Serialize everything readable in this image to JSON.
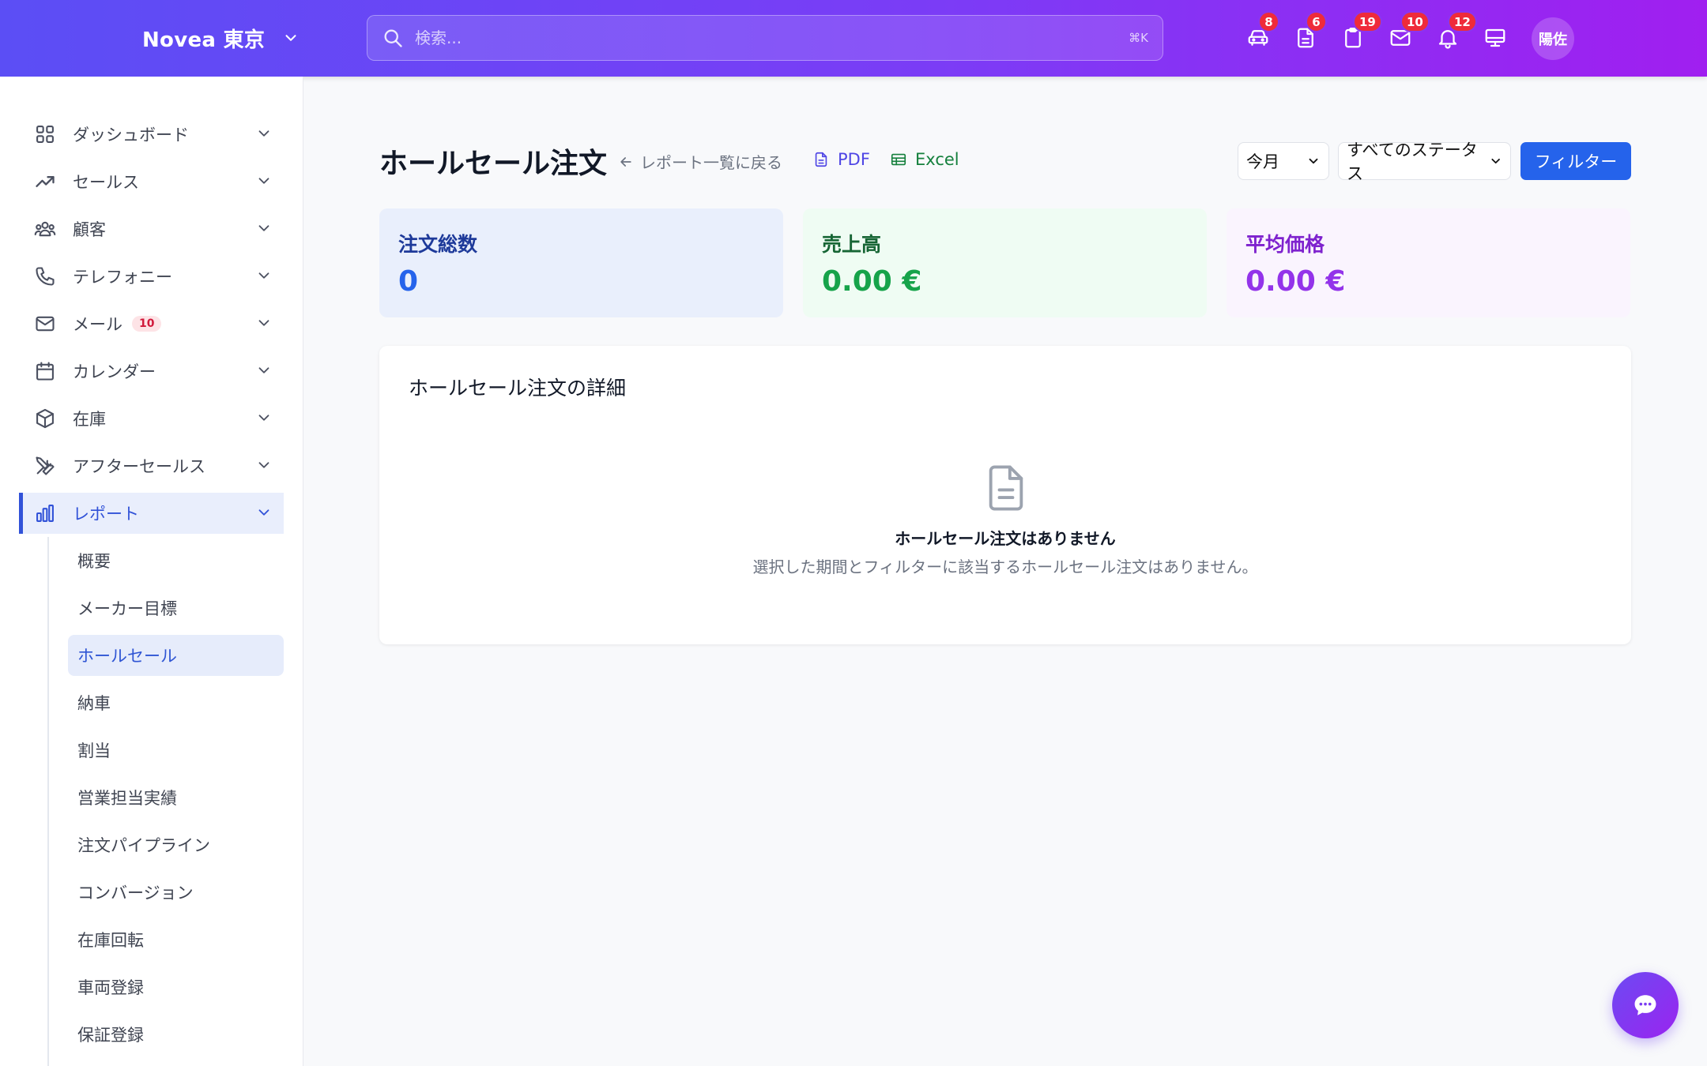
{
  "header": {
    "brand": "Novea 東京",
    "search_placeholder": "検索...",
    "search_shortcut": "⌘K",
    "icons": [
      {
        "name": "car-icon",
        "badge": "8"
      },
      {
        "name": "document-icon",
        "badge": "6"
      },
      {
        "name": "clipboard-icon",
        "badge": "19"
      },
      {
        "name": "mail-icon",
        "badge": "10"
      },
      {
        "name": "bell-icon",
        "badge": "12"
      },
      {
        "name": "monitor-icon",
        "badge": ""
      }
    ],
    "avatar": "陽佐"
  },
  "sidebar": {
    "items": [
      {
        "label": "ダッシュボード",
        "icon": "grid-icon"
      },
      {
        "label": "セールス",
        "icon": "trending-up-icon"
      },
      {
        "label": "顧客",
        "icon": "users-icon"
      },
      {
        "label": "テレフォニー",
        "icon": "phone-icon"
      },
      {
        "label": "メール",
        "icon": "mail-icon",
        "badge": "10"
      },
      {
        "label": "カレンダー",
        "icon": "calendar-icon"
      },
      {
        "label": "在庫",
        "icon": "box-icon"
      },
      {
        "label": "アフターセールス",
        "icon": "tools-icon"
      },
      {
        "label": "レポート",
        "icon": "bar-chart-icon",
        "active": true
      }
    ],
    "subitems": [
      {
        "label": "概要"
      },
      {
        "label": "メーカー目標"
      },
      {
        "label": "ホールセール",
        "active": true
      },
      {
        "label": "納車"
      },
      {
        "label": "割当"
      },
      {
        "label": "営業担当実績"
      },
      {
        "label": "注文パイプライン"
      },
      {
        "label": "コンバージョン"
      },
      {
        "label": "在庫回転"
      },
      {
        "label": "車両登録"
      },
      {
        "label": "保証登録"
      }
    ]
  },
  "main": {
    "title": "ホールセール注文",
    "back_label": "レポート一覧に戻る",
    "pdf_label": "PDF",
    "excel_label": "Excel",
    "period_select": "今月",
    "status_select": "すべてのステータス",
    "filter_button": "フィルター",
    "stats": [
      {
        "label": "注文総数",
        "value": "0"
      },
      {
        "label": "売上高",
        "value": "0.00 €"
      },
      {
        "label": "平均価格",
        "value": "0.00 €"
      }
    ],
    "detail": {
      "title": "ホールセール注文の詳細",
      "empty_title": "ホールセール注文はありません",
      "empty_desc": "選択した期間とフィルターに該当するホールセール注文はありません。"
    }
  },
  "colors": {
    "header_gradient_start": "#5b4ef5",
    "header_gradient_end": "#a01ff0",
    "accent": "#2563eb",
    "badge": "#ef2b3a"
  }
}
